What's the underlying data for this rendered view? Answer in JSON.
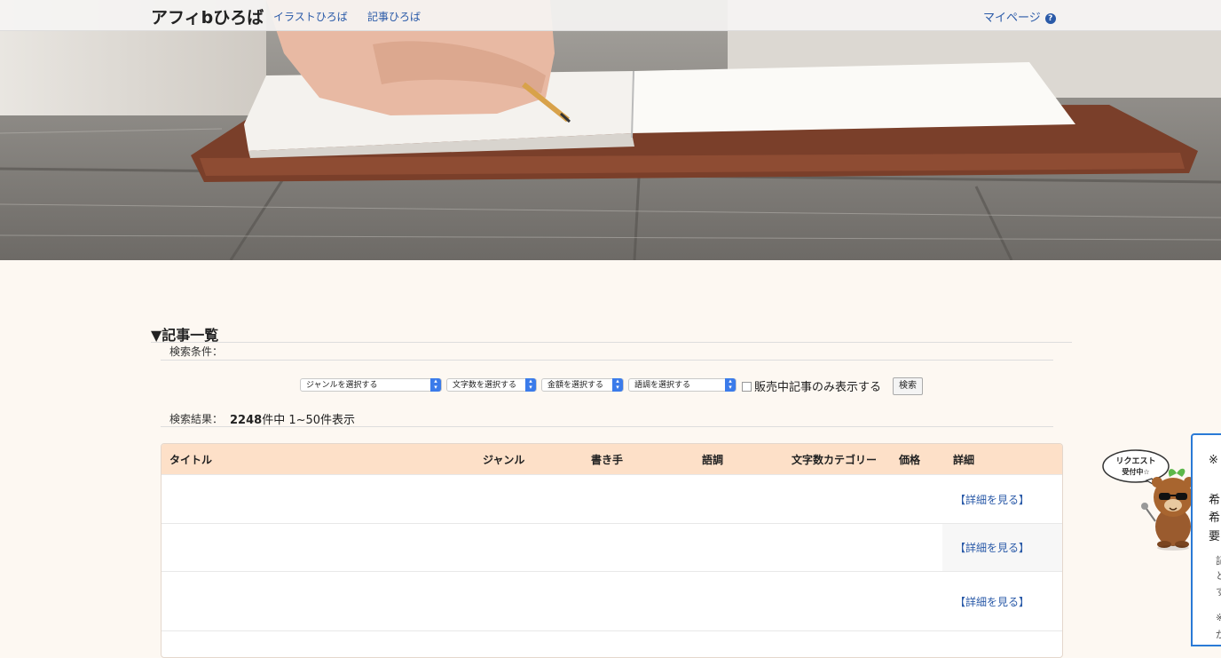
{
  "header": {
    "logo": "アフィbひろば",
    "nav": [
      "イラストひろば",
      "記事ひろば"
    ],
    "mypage": "マイページ",
    "help_glyph": "?"
  },
  "section": {
    "title": "▼記事一覧",
    "condition_label": "検索条件：",
    "filters": [
      "ジャンルを選択する",
      "文字数を選択する",
      "金額を選択する",
      "語調を選択する"
    ],
    "only_on_sale_label": "販売中記事のみ表示する",
    "search_button": "検索",
    "result_label": "検索結果：",
    "result_count": "2248",
    "result_suffix": "件中 1~50件表示"
  },
  "table": {
    "columns": [
      "タイトル",
      "ジャンル",
      "書き手",
      "語調",
      "文字数カテゴリー",
      "価格",
      "詳細"
    ],
    "rows": [
      {
        "detail": "【詳細を見る】"
      },
      {
        "detail": "【詳細を見る】"
      },
      {
        "detail": "【詳細を見る】"
      }
    ]
  },
  "mascot": {
    "bubble_line1": "リクエスト",
    "bubble_line2": "受付中☆"
  },
  "side_panel": {
    "lines": [
      "※",
      "希",
      "希",
      "要"
    ],
    "small_lines": [
      "記",
      "と",
      "す",
      "※",
      "が"
    ]
  },
  "colors": {
    "link": "#2a5aa8",
    "table_header": "#fde0c8",
    "page_bg": "#fdf8f2",
    "panel_border": "#2a7ad6"
  }
}
